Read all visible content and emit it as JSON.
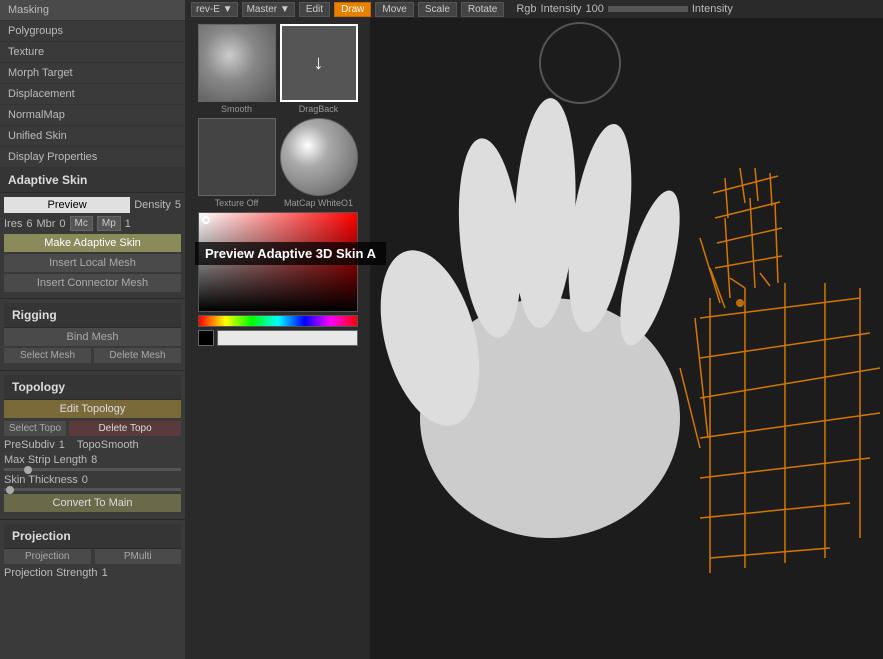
{
  "topbar": {
    "dropdown1": "rev-E ▼",
    "dropdown2": "Master ▼",
    "edit": "Edit",
    "draw": "Draw",
    "move": "Move",
    "scale": "Scale",
    "rotate": "Rotate",
    "rgb": "Rgb",
    "intensity_label": "Intensity",
    "intensity_value": "100",
    "intensity2_label": "Intensity"
  },
  "sidebar": {
    "masking": "Masking",
    "polygroups": "Polygroups",
    "texture": "Texture",
    "morph_target": "Morph Target",
    "displacement": "Displacement",
    "normalmap": "NormalMap",
    "unified_skin": "Unified Skin",
    "display_properties": "Display Properties",
    "adaptive_skin": "Adaptive Skin",
    "preview": "Preview",
    "density_label": "Density",
    "density_value": "5",
    "ires": "Ires",
    "ires_value": "6",
    "mbr": "Mbr",
    "mbr_value": "0",
    "mc": "Mc",
    "mp": "Mp",
    "pd_value": "1",
    "make_adaptive_skin": "Make Adaptive Skin",
    "insert_local_mesh": "Insert Local Mesh",
    "insert_connector_mesh": "Insert Connector Mesh",
    "rigging": "Rigging",
    "bind_mesh": "Bind Mesh",
    "select_mesh": "Select Mesh",
    "delete_mesh": "Delete Mesh",
    "topology": "Topology",
    "edit_topology": "Edit Topology",
    "select_topo": "Select Topo",
    "delete_topo": "Delete Topo",
    "presubdiv_label": "PreSubdiv",
    "presubdiv_value": "1",
    "toposmooth": "TopoSmooth",
    "max_strip_length": "Max Strip Length",
    "max_strip_value": "8",
    "skin_thickness": "Skin Thickness",
    "skin_thickness_value": "0",
    "convert_to_main": "Convert To Main",
    "projection": "Projection",
    "projection_label": "Projection",
    "pmulti": "PMulti",
    "projection_strength": "Projection Strength",
    "projection_strength_value": "1"
  },
  "tooltip": {
    "text": "Preview Adaptive 3D Skin  A"
  },
  "thumbnails": {
    "smooth_label": "Smooth",
    "dragback_label": "DragBack",
    "texture_off_label": "Texture Off",
    "matcap_label": "MatCap WhiteO1"
  },
  "colors": {
    "accent_orange": "#e88000",
    "sidebar_bg": "#3a3a3a",
    "btn_highlight": "#8a8a5a",
    "edit_topo_color": "#7a6a3a"
  }
}
